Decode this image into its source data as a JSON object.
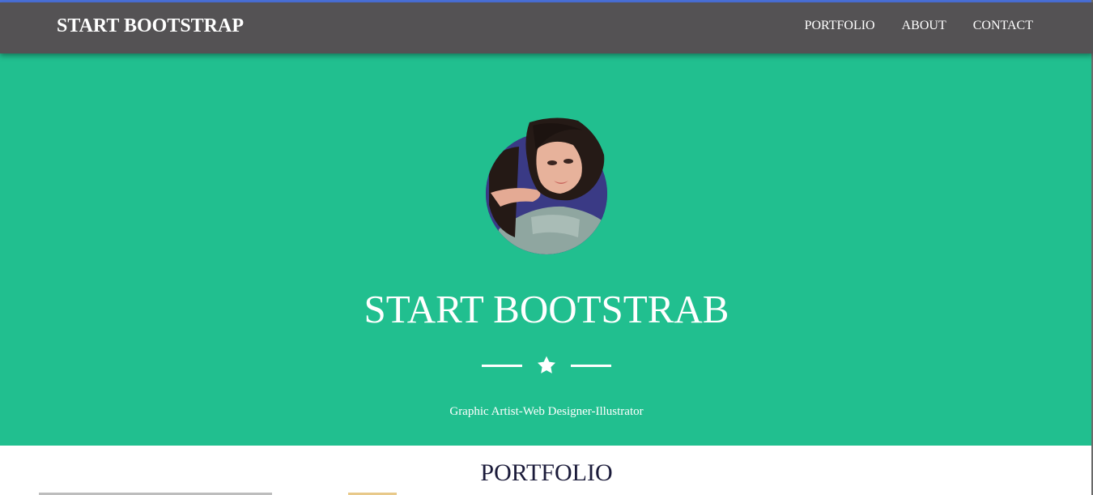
{
  "navbar": {
    "brand": "START BOOTSTRAP",
    "links": [
      "PORTFOLIO",
      "ABOUT",
      "CONTACT"
    ]
  },
  "hero": {
    "title": "START BOOTSTRAB",
    "subtitle": "Graphic Artist-Web Designer-Illustrator",
    "divider_icon": "star-icon"
  },
  "portfolio": {
    "heading": "PORTFOLIO"
  },
  "colors": {
    "navbar_bg": "#545254",
    "hero_bg": "#21bf8f",
    "avatar_ring": "#2a2f7a",
    "text_light": "#ffffff",
    "heading_dark": "#1b1b3a"
  }
}
